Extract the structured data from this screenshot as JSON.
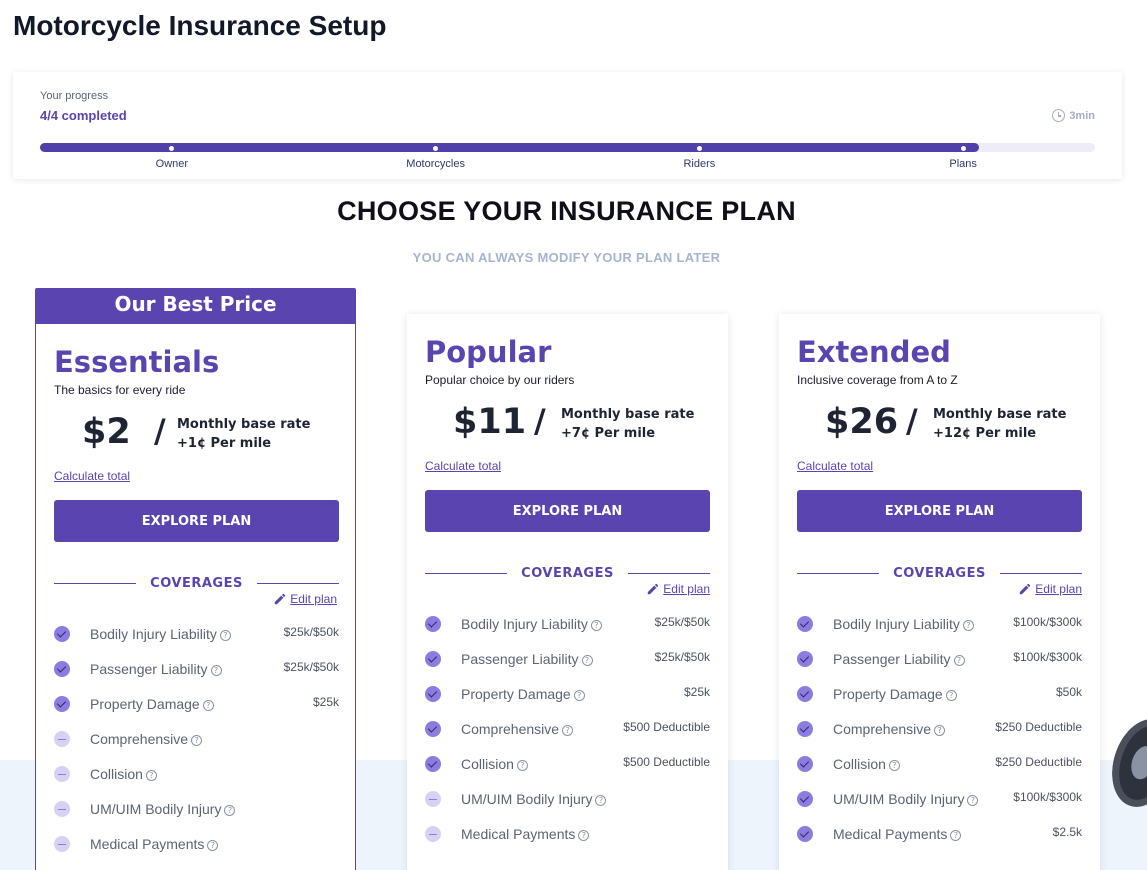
{
  "page_title": "Motorcycle Insurance Setup",
  "progress": {
    "label": "Your progress",
    "status": "4/4 completed",
    "time": "3min",
    "fill_fraction": 0.89,
    "steps": [
      "Owner",
      "Motorcycles",
      "Riders",
      "Plans"
    ]
  },
  "section": {
    "title": "CHOOSE YOUR INSURANCE PLAN",
    "subtitle": "YOU CAN ALWAYS MODIFY YOUR PLAN LATER"
  },
  "common": {
    "rate_label": "Monthly base rate",
    "calc_link": "Calculate total",
    "explore_label": "EXPLORE PLAN",
    "coverages_label": "COVERAGES",
    "edit_label": "Edit plan",
    "price_sep": "/",
    "help_glyph": "?"
  },
  "colors": {
    "accent": "#5a44b0",
    "check": "#8b7ce0",
    "check_off": "#d7d2f3",
    "subtitle": "#a7b4d1"
  },
  "plans": [
    {
      "badge": "Our Best Price",
      "name": "Essentials",
      "tagline": "The basics for every ride",
      "price": "$2",
      "per_mile": "+1¢ Per mile",
      "coverages": [
        {
          "name": "Bodily Injury Liability",
          "included": true,
          "value": "$25k/$50k"
        },
        {
          "name": "Passenger Liability",
          "included": true,
          "value": "$25k/$50k"
        },
        {
          "name": "Property Damage",
          "included": true,
          "value": "$25k"
        },
        {
          "name": "Comprehensive",
          "included": false,
          "value": ""
        },
        {
          "name": "Collision",
          "included": false,
          "value": ""
        },
        {
          "name": "UM/UIM Bodily Injury",
          "included": false,
          "value": ""
        },
        {
          "name": "Medical Payments",
          "included": false,
          "value": ""
        }
      ]
    },
    {
      "badge": "",
      "name": "Popular",
      "tagline": "Popular choice by our riders",
      "price": "$11",
      "per_mile": "+7¢ Per mile",
      "coverages": [
        {
          "name": "Bodily Injury Liability",
          "included": true,
          "value": "$25k/$50k"
        },
        {
          "name": "Passenger Liability",
          "included": true,
          "value": "$25k/$50k"
        },
        {
          "name": "Property Damage",
          "included": true,
          "value": "$25k"
        },
        {
          "name": "Comprehensive",
          "included": true,
          "value": "$500 Deductible"
        },
        {
          "name": "Collision",
          "included": true,
          "value": "$500 Deductible"
        },
        {
          "name": "UM/UIM Bodily Injury",
          "included": false,
          "value": ""
        },
        {
          "name": "Medical Payments",
          "included": false,
          "value": ""
        }
      ]
    },
    {
      "badge": "",
      "name": "Extended",
      "tagline": "Inclusive coverage from A to Z",
      "price": "$26",
      "per_mile": "+12¢ Per mile",
      "coverages": [
        {
          "name": "Bodily Injury Liability",
          "included": true,
          "value": "$100k/$300k"
        },
        {
          "name": "Passenger Liability",
          "included": true,
          "value": "$100k/$300k"
        },
        {
          "name": "Property Damage",
          "included": true,
          "value": "$50k"
        },
        {
          "name": "Comprehensive",
          "included": true,
          "value": "$250 Deductible"
        },
        {
          "name": "Collision",
          "included": true,
          "value": "$250 Deductible"
        },
        {
          "name": "UM/UIM Bodily Injury",
          "included": true,
          "value": "$100k/$300k"
        },
        {
          "name": "Medical Payments",
          "included": true,
          "value": "$2.5k"
        }
      ]
    }
  ],
  "icons": {
    "clock": "clock-icon",
    "pencil": "pencil-icon",
    "included": "check-circle-icon",
    "excluded": "minus-circle-icon",
    "help": "help-circle-icon"
  }
}
